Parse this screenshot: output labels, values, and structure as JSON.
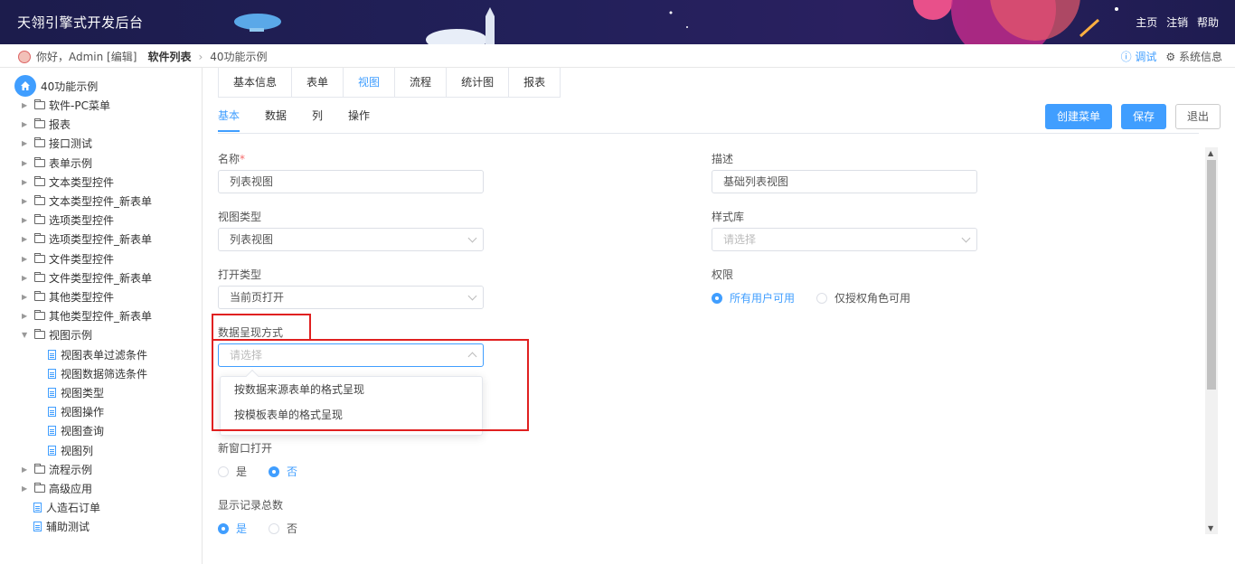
{
  "header": {
    "title": "天翎引擎式开发后台",
    "nav": [
      "主页",
      "注销",
      "帮助"
    ]
  },
  "crumb": {
    "greeting": "你好，Admin [编辑]",
    "section": "软件列表",
    "current": "40功能示例",
    "debug": "调试",
    "sysinfo": "系统信息"
  },
  "sidebar": {
    "root": "40功能示例",
    "items": [
      {
        "label": "软件-PC菜单",
        "type": "folder"
      },
      {
        "label": "报表",
        "type": "folder"
      },
      {
        "label": "接口测试",
        "type": "folder"
      },
      {
        "label": "表单示例",
        "type": "folder"
      },
      {
        "label": "文本类型控件",
        "type": "folder"
      },
      {
        "label": "文本类型控件_新表单",
        "type": "folder"
      },
      {
        "label": "选项类型控件",
        "type": "folder"
      },
      {
        "label": "选项类型控件_新表单",
        "type": "folder"
      },
      {
        "label": "文件类型控件",
        "type": "folder"
      },
      {
        "label": "文件类型控件_新表单",
        "type": "folder"
      },
      {
        "label": "其他类型控件",
        "type": "folder"
      },
      {
        "label": "其他类型控件_新表单",
        "type": "folder"
      },
      {
        "label": "视图示例",
        "type": "folder-open"
      },
      {
        "label": "视图表单过滤条件",
        "type": "doc"
      },
      {
        "label": "视图数据筛选条件",
        "type": "doc"
      },
      {
        "label": "视图类型",
        "type": "doc"
      },
      {
        "label": "视图操作",
        "type": "doc"
      },
      {
        "label": "视图查询",
        "type": "doc"
      },
      {
        "label": "视图列",
        "type": "doc"
      },
      {
        "label": "流程示例",
        "type": "folder"
      },
      {
        "label": "高级应用",
        "type": "folder"
      },
      {
        "label": "人造石订单",
        "type": "doc-root"
      },
      {
        "label": "辅助测试",
        "type": "doc-root"
      }
    ]
  },
  "tabs": [
    "基本信息",
    "表单",
    "视图",
    "流程",
    "统计图",
    "报表"
  ],
  "subtabs": [
    "基本",
    "数据",
    "列",
    "操作"
  ],
  "buttons": {
    "create_menu": "创建菜单",
    "save": "保存",
    "exit": "退出"
  },
  "form": {
    "name_label": "名称",
    "name_req": "*",
    "name_value": "列表视图",
    "desc_label": "描述",
    "desc_value": "基础列表视图",
    "viewtype_label": "视图类型",
    "viewtype_value": "列表视图",
    "style_label": "样式库",
    "style_placeholder": "请选择",
    "opentype_label": "打开类型",
    "opentype_value": "当前页打开",
    "perm_label": "权限",
    "perm_opt1": "所有用户可用",
    "perm_opt2": "仅授权角色可用",
    "present_label": "数据呈现方式",
    "present_placeholder": "请选择",
    "present_options": [
      "按数据来源表单的格式呈现",
      "按模板表单的格式呈现"
    ],
    "newwin_label": "新窗口打开",
    "newwin_yes": "是",
    "newwin_no": "否",
    "showcount_label": "显示记录总数",
    "showcount_yes": "是",
    "showcount_no": "否"
  },
  "colors": {
    "accent": "#409eff",
    "highlight": "#e02020",
    "header_bg": "#1c1c4c"
  }
}
